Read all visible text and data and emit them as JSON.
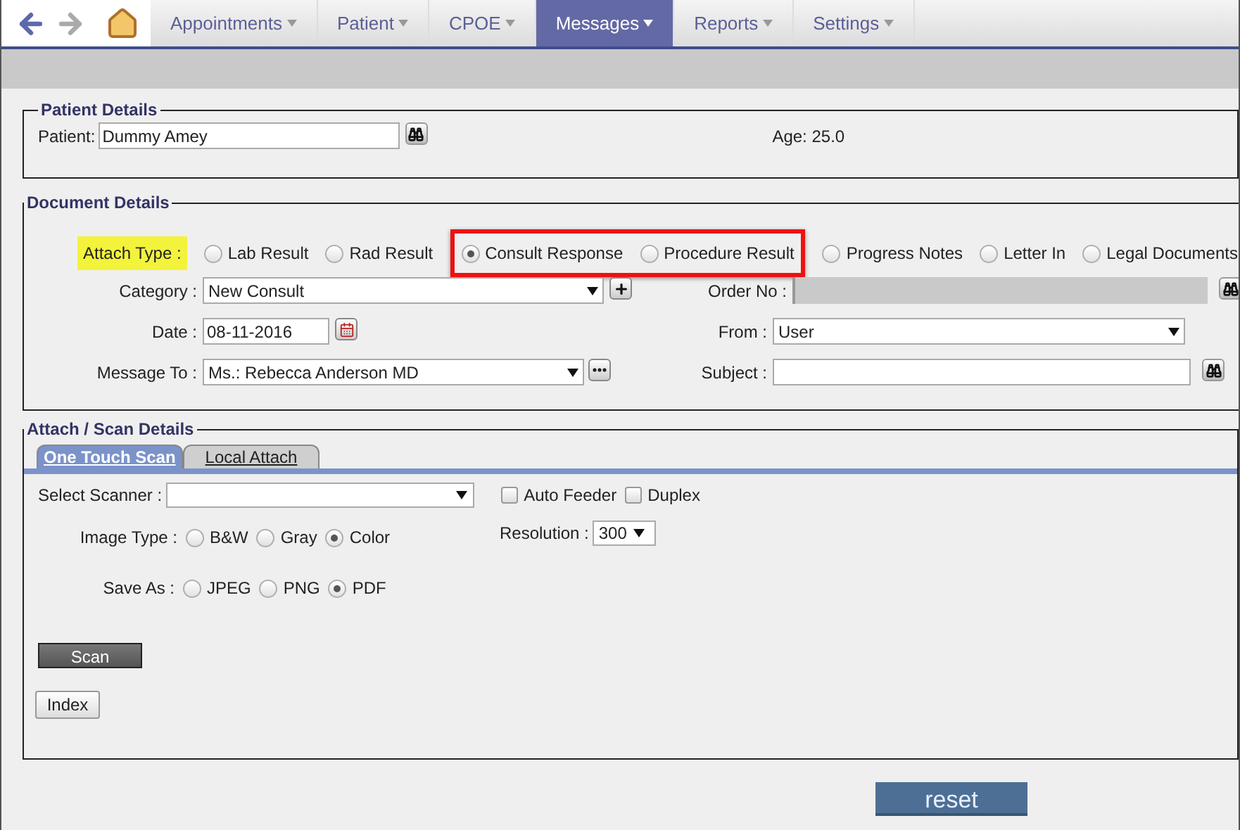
{
  "menu": [
    {
      "label": "Appointments",
      "selected": false
    },
    {
      "label": "Patient",
      "selected": false
    },
    {
      "label": "CPOE",
      "selected": false
    },
    {
      "label": "Messages",
      "selected": true
    },
    {
      "label": "Reports",
      "selected": false
    },
    {
      "label": "Settings",
      "selected": false
    }
  ],
  "patient_details": {
    "legend": "Patient Details",
    "patient_label": "Patient:",
    "patient_value": "Dummy Amey",
    "age": "Age: 25.0"
  },
  "document_details": {
    "legend": "Document Details",
    "attach_type": {
      "label": "Attach Type :",
      "highlighted": true,
      "options": [
        {
          "label": "Lab Result",
          "selected": false,
          "highlighted": false
        },
        {
          "label": "Rad Result",
          "selected": false,
          "highlighted": false
        },
        {
          "label": "Consult Response",
          "selected": true,
          "highlighted": true
        },
        {
          "label": "Procedure Result",
          "selected": false,
          "highlighted": true
        },
        {
          "label": "Progress Notes",
          "selected": false,
          "highlighted": false
        },
        {
          "label": "Letter In",
          "selected": false,
          "highlighted": false
        },
        {
          "label": "Legal Documents",
          "selected": false,
          "highlighted": false
        }
      ]
    },
    "category": {
      "label": "Category :",
      "value": "New Consult"
    },
    "order_no": {
      "label": "Order No :",
      "disabled": true
    },
    "date": {
      "label": "Date :",
      "value": "08-11-2016"
    },
    "from": {
      "label": "From :",
      "value": "User"
    },
    "message_to": {
      "label": "Message To :",
      "value": "Ms.: Rebecca Anderson MD"
    },
    "subject": {
      "label": "Subject :"
    }
  },
  "scan_details": {
    "legend": "Attach / Scan Details",
    "tabs": [
      {
        "label": "One Touch Scan",
        "selected": true
      },
      {
        "label": "Local Attach",
        "selected": false
      }
    ],
    "scanner_label": "Select Scanner :",
    "checkboxes": [
      {
        "label": "Auto Feeder",
        "checked": false
      },
      {
        "label": "Duplex",
        "checked": false
      }
    ],
    "image_type": {
      "label": "Image Type :",
      "options": [
        {
          "label": "B&W",
          "selected": false
        },
        {
          "label": "Gray",
          "selected": false
        },
        {
          "label": "Color",
          "selected": true
        }
      ]
    },
    "resolution": {
      "label": "Resolution :",
      "value": "300"
    },
    "save_as": {
      "label": "Save As :",
      "options": [
        {
          "label": "JPEG",
          "selected": false
        },
        {
          "label": "PNG",
          "selected": false
        },
        {
          "label": "PDF",
          "selected": true
        }
      ]
    },
    "scan_button": "Scan",
    "index_button": "Index"
  },
  "reset_button": "reset"
}
